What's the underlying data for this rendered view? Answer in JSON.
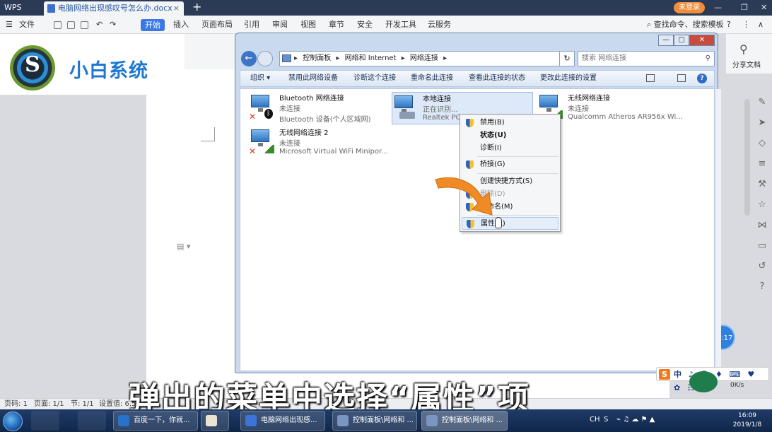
{
  "wps": {
    "app_name": "WPS",
    "doc_tab": "电脑网络出现感叹号怎么办.docx",
    "new_tab": "+",
    "login": "未登录",
    "menus": [
      "文件",
      "开始",
      "插入",
      "页面布局",
      "引用",
      "审阅",
      "视图",
      "章节",
      "安全",
      "开发工具",
      "云服务"
    ],
    "active_menu": "开始",
    "find_label": "查找命令、搜索模板",
    "share_label": "分享文档"
  },
  "logo": {
    "text": "小白系统"
  },
  "explorer": {
    "breadcrumbs": [
      "控制面板",
      "网络和 Internet",
      "网络连接"
    ],
    "search_placeholder": "搜索 网络连接",
    "commands": [
      "组织 ▾",
      "禁用此网络设备",
      "诊断这个连接",
      "重命名此连接",
      "查看此连接的状态",
      "更改此连接的设置"
    ],
    "connections": [
      {
        "name": "Bluetooth 网络连接",
        "status": "未连接",
        "device": "Bluetooth 设备(个人区域网)"
      },
      {
        "name": "本地连接",
        "status": "正在识别...",
        "device": "Realtek PCI"
      },
      {
        "name": "无线网络连接",
        "status": "未连接",
        "device": "Qualcomm Atheros AR956x Wi..."
      },
      {
        "name": "无线网络连接 2",
        "status": "未连接",
        "device": "Microsoft Virtual WiFi Minipor..."
      }
    ]
  },
  "context_menu": {
    "items": [
      {
        "label": "禁用(B)"
      },
      {
        "label": "状态(U)"
      },
      {
        "label": "诊断(I)"
      },
      {
        "label": "桥接(G)"
      },
      {
        "label": "创建快捷方式(S)"
      },
      {
        "label": "删除(D)"
      },
      {
        "label": "重命名(M)"
      },
      {
        "label": "属性(R)"
      }
    ]
  },
  "timer": "00:17",
  "status_bar": {
    "page_num": "页码: 1",
    "pages": "页面: 1/1",
    "section": "节: 1/1",
    "settings": "设置值: 6.5"
  },
  "subtitle": "弹出的菜单中选择“属性”项",
  "ime": {
    "label": "中 ♪ ☺ ♦ ⌨ ♥ ✿ ☷"
  },
  "net_speed": "0K/s",
  "taskbar": {
    "tasks": [
      "百度一下，你就...",
      "电脑网络出现感...",
      "控制面板\\网络和 ...",
      "控制面板\\网络和 ..."
    ],
    "lang": "CH",
    "time": "16:09",
    "date": "2019/1/8"
  },
  "colors": {
    "wps_title": "#2b3a55",
    "accent": "#3b78e7",
    "logo_blue": "#1e78d2",
    "arrow": "#f08a25",
    "taskbar": "#10274b"
  }
}
